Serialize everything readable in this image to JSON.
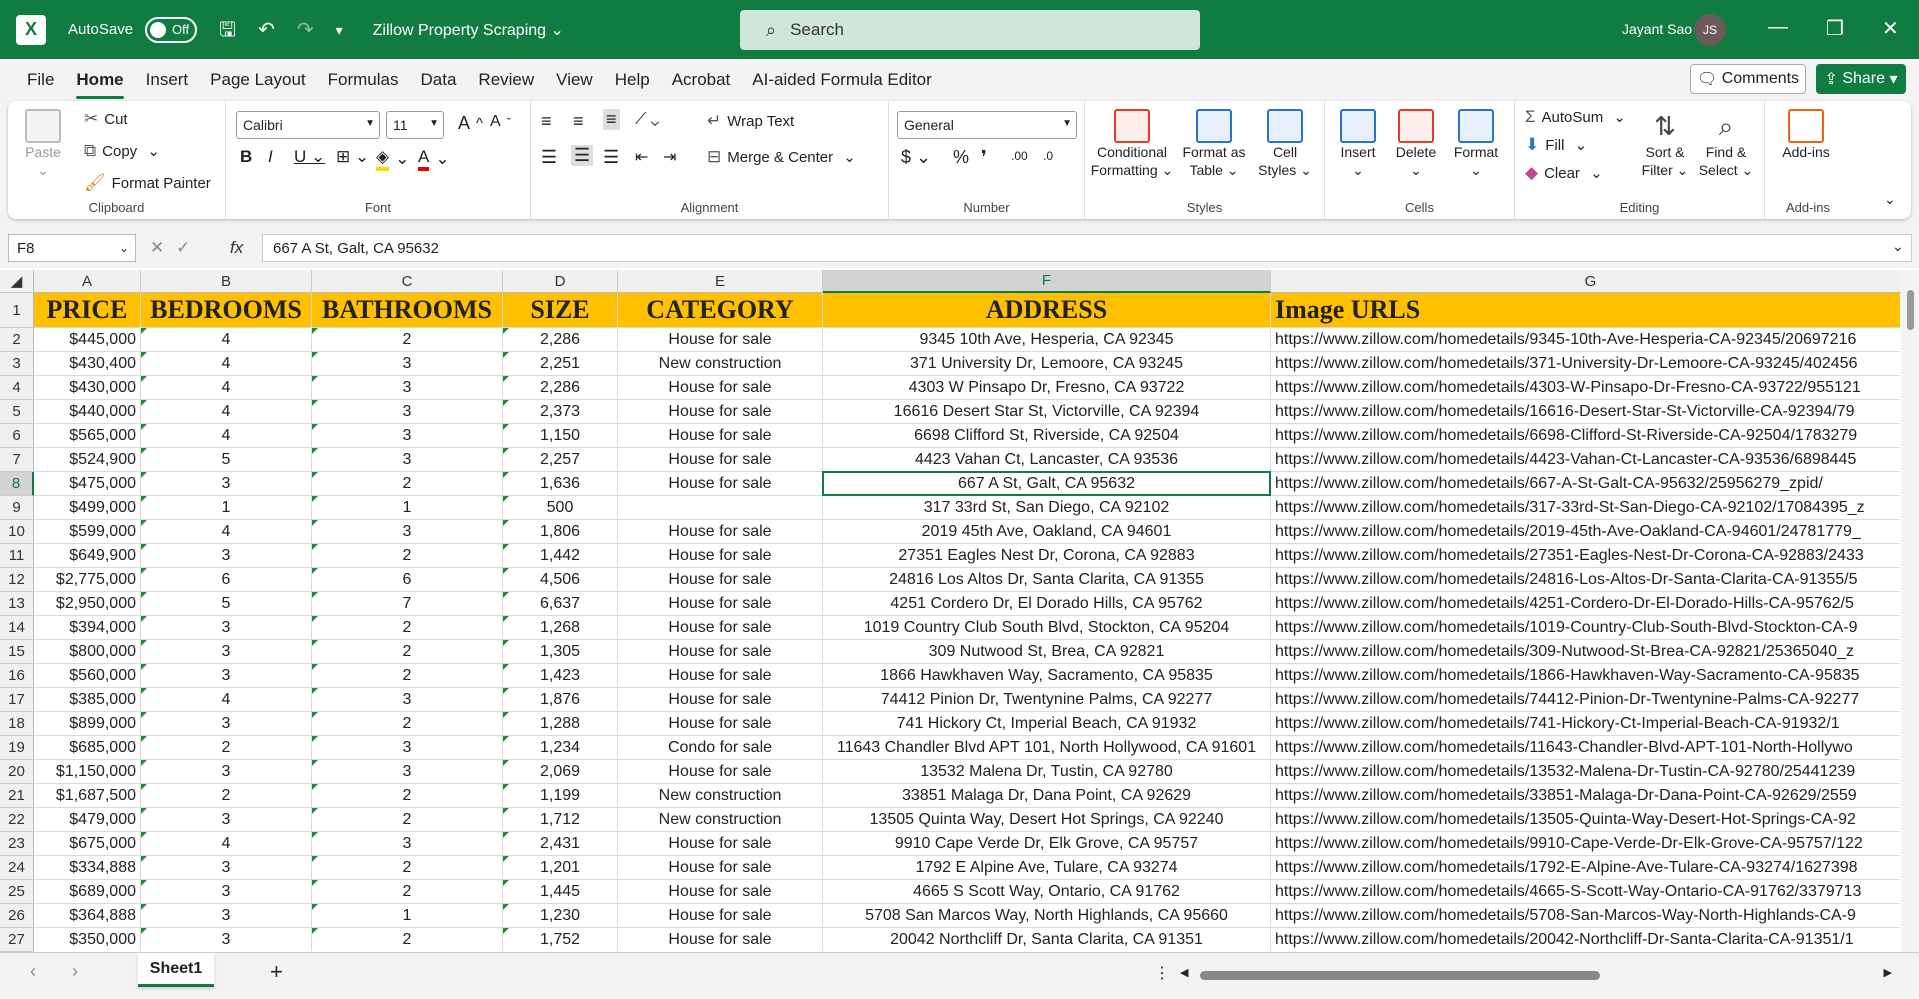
{
  "titlebar": {
    "autosave_label": "AutoSave",
    "autosave_state": "Off",
    "doc_title": "Zillow Property Scraping",
    "search_placeholder": "Search",
    "user_name": "Jayant Sao",
    "user_initials": "JS"
  },
  "menu": [
    "File",
    "Home",
    "Insert",
    "Page Layout",
    "Formulas",
    "Data",
    "Review",
    "View",
    "Help",
    "Acrobat",
    "AI-aided Formula Editor"
  ],
  "menu_active": "Home",
  "top_buttons": {
    "comments": "Comments",
    "share": "Share"
  },
  "ribbon": {
    "clipboard": {
      "paste": "Paste",
      "cut": "Cut",
      "copy": "Copy",
      "format_painter": "Format Painter",
      "label": "Clipboard"
    },
    "font": {
      "family": "Calibri",
      "size": "11",
      "label": "Font"
    },
    "alignment": {
      "wrap": "Wrap Text",
      "merge": "Merge & Center",
      "label": "Alignment"
    },
    "number": {
      "format": "General",
      "label": "Number"
    },
    "styles": {
      "cond1": "Conditional",
      "cond2": "Formatting",
      "fmt1": "Format as",
      "fmt2": "Table",
      "cell1": "Cell",
      "cell2": "Styles",
      "label": "Styles"
    },
    "cells": {
      "insert": "Insert",
      "delete": "Delete",
      "format": "Format",
      "label": "Cells"
    },
    "editing": {
      "autosum": "AutoSum",
      "fill": "Fill",
      "clear": "Clear",
      "sort1": "Sort &",
      "sort2": "Filter",
      "find1": "Find &",
      "find2": "Select",
      "label": "Editing"
    },
    "addins": {
      "addins": "Add-ins",
      "label": "Add-ins"
    }
  },
  "formula_bar": {
    "name_box": "F8",
    "content": "667 A St, Galt, CA 95632"
  },
  "columns": [
    "A",
    "B",
    "C",
    "D",
    "E",
    "F",
    "G"
  ],
  "header_row": [
    "PRICE",
    "BEDROOMS",
    "BATHROOMS",
    "SIZE",
    "CATEGORY",
    "ADDRESS",
    "Image URLS"
  ],
  "rows": [
    [
      "$445,000",
      "4",
      "2",
      "2,286",
      "House for sale",
      "9345 10th Ave, Hesperia, CA 92345",
      "https://www.zillow.com/homedetails/9345-10th-Ave-Hesperia-CA-92345/20697216"
    ],
    [
      "$430,400",
      "4",
      "3",
      "2,251",
      "New construction",
      "371 University Dr, Lemoore, CA 93245",
      "https://www.zillow.com/homedetails/371-University-Dr-Lemoore-CA-93245/402456"
    ],
    [
      "$430,000",
      "4",
      "3",
      "2,286",
      "House for sale",
      "4303 W Pinsapo Dr, Fresno, CA 93722",
      "https://www.zillow.com/homedetails/4303-W-Pinsapo-Dr-Fresno-CA-93722/955121"
    ],
    [
      "$440,000",
      "4",
      "3",
      "2,373",
      "House for sale",
      "16616 Desert Star St, Victorville, CA 92394",
      "https://www.zillow.com/homedetails/16616-Desert-Star-St-Victorville-CA-92394/79"
    ],
    [
      "$565,000",
      "4",
      "3",
      "1,150",
      "House for sale",
      "6698 Clifford St, Riverside, CA 92504",
      "https://www.zillow.com/homedetails/6698-Clifford-St-Riverside-CA-92504/1783279"
    ],
    [
      "$524,900",
      "5",
      "3",
      "2,257",
      "House for sale",
      "4423 Vahan Ct, Lancaster, CA 93536",
      "https://www.zillow.com/homedetails/4423-Vahan-Ct-Lancaster-CA-93536/6898445"
    ],
    [
      "$475,000",
      "3",
      "2",
      "1,636",
      "House for sale",
      "667 A St, Galt, CA 95632",
      "https://www.zillow.com/homedetails/667-A-St-Galt-CA-95632/25956279_zpid/"
    ],
    [
      "$499,000",
      "1",
      "1",
      "500",
      "",
      "317 33rd St, San Diego, CA 92102",
      "https://www.zillow.com/homedetails/317-33rd-St-San-Diego-CA-92102/17084395_z"
    ],
    [
      "$599,000",
      "4",
      "3",
      "1,806",
      "House for sale",
      "2019 45th Ave, Oakland, CA 94601",
      "https://www.zillow.com/homedetails/2019-45th-Ave-Oakland-CA-94601/24781779_"
    ],
    [
      "$649,900",
      "3",
      "2",
      "1,442",
      "House for sale",
      "27351 Eagles Nest Dr, Corona, CA 92883",
      "https://www.zillow.com/homedetails/27351-Eagles-Nest-Dr-Corona-CA-92883/2433"
    ],
    [
      "$2,775,000",
      "6",
      "6",
      "4,506",
      "House for sale",
      "24816 Los Altos Dr, Santa Clarita, CA 91355",
      "https://www.zillow.com/homedetails/24816-Los-Altos-Dr-Santa-Clarita-CA-91355/5"
    ],
    [
      "$2,950,000",
      "5",
      "7",
      "6,637",
      "House for sale",
      "4251 Cordero Dr, El Dorado Hills, CA 95762",
      "https://www.zillow.com/homedetails/4251-Cordero-Dr-El-Dorado-Hills-CA-95762/5"
    ],
    [
      "$394,000",
      "3",
      "2",
      "1,268",
      "House for sale",
      "1019 Country Club South Blvd, Stockton, CA 95204",
      "https://www.zillow.com/homedetails/1019-Country-Club-South-Blvd-Stockton-CA-9"
    ],
    [
      "$800,000",
      "3",
      "2",
      "1,305",
      "House for sale",
      "309 Nutwood St, Brea, CA 92821",
      "https://www.zillow.com/homedetails/309-Nutwood-St-Brea-CA-92821/25365040_z"
    ],
    [
      "$560,000",
      "3",
      "2",
      "1,423",
      "House for sale",
      "1866 Hawkhaven Way, Sacramento, CA 95835",
      "https://www.zillow.com/homedetails/1866-Hawkhaven-Way-Sacramento-CA-95835"
    ],
    [
      "$385,000",
      "4",
      "3",
      "1,876",
      "House for sale",
      "74412 Pinion Dr, Twentynine Palms, CA 92277",
      "https://www.zillow.com/homedetails/74412-Pinion-Dr-Twentynine-Palms-CA-92277"
    ],
    [
      "$899,000",
      "3",
      "2",
      "1,288",
      "House for sale",
      "741 Hickory Ct, Imperial Beach, CA 91932",
      "https://www.zillow.com/homedetails/741-Hickory-Ct-Imperial-Beach-CA-91932/1"
    ],
    [
      "$685,000",
      "2",
      "3",
      "1,234",
      "Condo for sale",
      "11643 Chandler Blvd APT 101, North Hollywood, CA 91601",
      "https://www.zillow.com/homedetails/11643-Chandler-Blvd-APT-101-North-Hollywo"
    ],
    [
      "$1,150,000",
      "3",
      "3",
      "2,069",
      "House for sale",
      "13532 Malena Dr, Tustin, CA 92780",
      "https://www.zillow.com/homedetails/13532-Malena-Dr-Tustin-CA-92780/25441239"
    ],
    [
      "$1,687,500",
      "2",
      "2",
      "1,199",
      "New construction",
      "33851 Malaga Dr, Dana Point, CA 92629",
      "https://www.zillow.com/homedetails/33851-Malaga-Dr-Dana-Point-CA-92629/2559"
    ],
    [
      "$479,000",
      "3",
      "2",
      "1,712",
      "New construction",
      "13505 Quinta Way, Desert Hot Springs, CA 92240",
      "https://www.zillow.com/homedetails/13505-Quinta-Way-Desert-Hot-Springs-CA-92"
    ],
    [
      "$675,000",
      "4",
      "3",
      "2,431",
      "House for sale",
      "9910 Cape Verde Dr, Elk Grove, CA 95757",
      "https://www.zillow.com/homedetails/9910-Cape-Verde-Dr-Elk-Grove-CA-95757/122"
    ],
    [
      "$334,888",
      "3",
      "2",
      "1,201",
      "House for sale",
      "1792 E Alpine Ave, Tulare, CA 93274",
      "https://www.zillow.com/homedetails/1792-E-Alpine-Ave-Tulare-CA-93274/1627398"
    ],
    [
      "$689,000",
      "3",
      "2",
      "1,445",
      "House for sale",
      "4665 S Scott Way, Ontario, CA 91762",
      "https://www.zillow.com/homedetails/4665-S-Scott-Way-Ontario-CA-91762/3379713"
    ],
    [
      "$364,888",
      "3",
      "1",
      "1,230",
      "House for sale",
      "5708 San Marcos Way, North Highlands, CA 95660",
      "https://www.zillow.com/homedetails/5708-San-Marcos-Way-North-Highlands-CA-9"
    ],
    [
      "$350,000",
      "3",
      "2",
      "1,752",
      "House for sale",
      "20042 Northcliff Dr, Santa Clarita, CA 91351",
      "https://www.zillow.com/homedetails/20042-Northcliff-Dr-Santa-Clarita-CA-91351/1"
    ]
  ],
  "selected_cell": {
    "column": "F",
    "row": "8"
  },
  "sheet_tab": "Sheet1",
  "colors": {
    "excel_green": "#107c41",
    "header_fill": "#ffc000"
  }
}
